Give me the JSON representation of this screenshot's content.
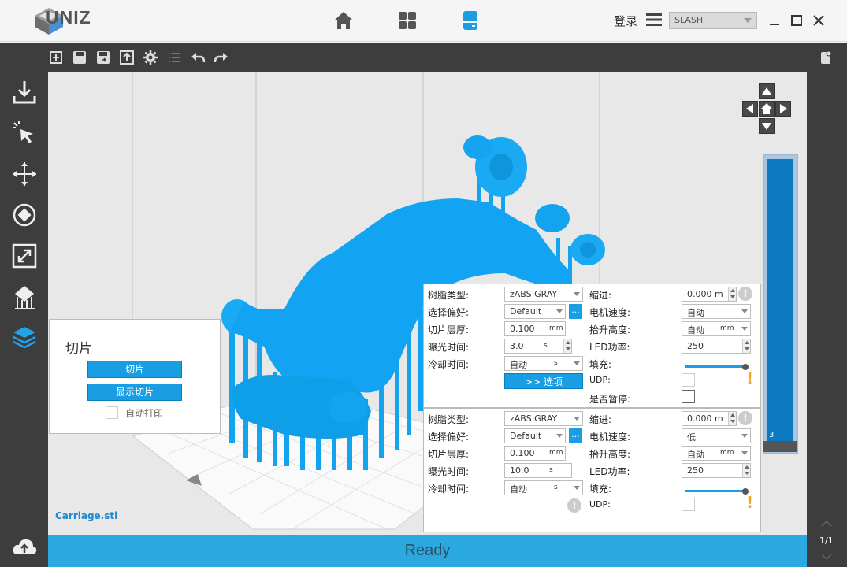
{
  "app": {
    "logo_text": "UNIZ",
    "login_label": "登录",
    "printer_model": "SLASH"
  },
  "titlebar": {
    "nav_icons": [
      "home-icon",
      "grid-icon",
      "printer-icon"
    ],
    "window_icons": [
      "minimize-icon",
      "maximize-icon",
      "close-icon"
    ]
  },
  "toolbar": {
    "icons": [
      "add-model-icon",
      "save-icon",
      "save-as-icon",
      "export-icon",
      "settings-icon",
      "list-icon",
      "undo-icon",
      "redo-icon"
    ]
  },
  "sidebar": {
    "icons": [
      "import-icon",
      "select-icon",
      "move-icon",
      "rotate-icon",
      "scale-icon",
      "support-icon",
      "layers-icon",
      "upload-icon"
    ]
  },
  "viewport": {
    "filename": "Carriage.stl",
    "layer_value": "3",
    "page_counter": "1/1"
  },
  "slice_panel": {
    "title": "切片",
    "slice_button": "切片",
    "show_slice_button": "显示切片",
    "auto_print_label": "自动打印"
  },
  "settings_a": {
    "resin_label": "树脂类型:",
    "resin_value": "zABS GRAY",
    "pref_label": "选择偏好:",
    "pref_value": "Default",
    "pref_dots": "...",
    "layer_label": "切片层厚:",
    "layer_value": "0.100",
    "layer_unit": "mm",
    "exposure_label": "曝光时间:",
    "exposure_value": "3.0",
    "exposure_unit": "s",
    "cool_label": "冷却时间:",
    "cool_value": "自动",
    "cool_unit": "s",
    "options_button": ">> 选项",
    "shrink_label": "缩进:",
    "shrink_value": "0.000 m",
    "motor_label": "电机速度:",
    "motor_value": "自动",
    "lift_label": "抬升高度:",
    "lift_value": "自动",
    "lift_unit": "mm",
    "led_label": "LED功率:",
    "led_value": "250",
    "fill_label": "填充:",
    "udp_label": "UDP:",
    "pause_label": "是否暂停:"
  },
  "settings_b": {
    "resin_label": "树脂类型:",
    "resin_value": "zABS GRAY",
    "pref_label": "选择偏好:",
    "pref_value": "Default",
    "pref_dots": "...",
    "layer_label": "切片层厚:",
    "layer_value": "0.100",
    "layer_unit": "mm",
    "exposure_label": "曝光时间:",
    "exposure_value": "10.0",
    "exposure_unit": "s",
    "cool_label": "冷却时间:",
    "cool_value": "自动",
    "cool_unit": "s",
    "shrink_label": "缩进:",
    "shrink_value": "0.000 m",
    "motor_label": "电机速度:",
    "motor_value": "低",
    "lift_label": "抬升高度:",
    "lift_value": "自动",
    "lift_unit": "mm",
    "led_label": "LED功率:",
    "led_value": "250",
    "fill_label": "填充:",
    "udp_label": "UDP:"
  },
  "status": {
    "text": "Ready"
  },
  "colors": {
    "accent": "#1a9ee3",
    "model": "#12a4f2",
    "status_bar": "#2aa9e0",
    "dark_bar": "#3d3d3d"
  }
}
